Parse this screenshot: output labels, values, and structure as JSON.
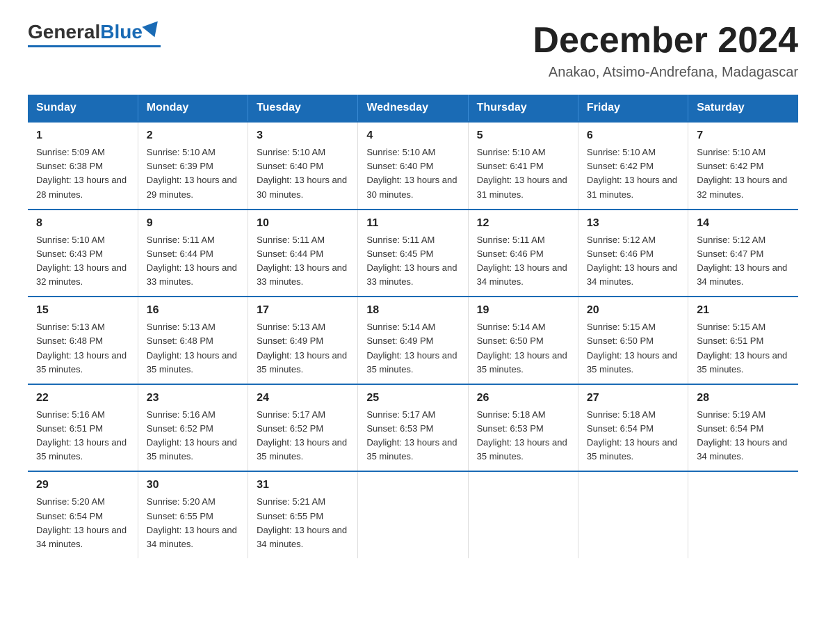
{
  "header": {
    "logo_general": "General",
    "logo_blue": "Blue",
    "month_year": "December 2024",
    "location": "Anakao, Atsimo-Andrefana, Madagascar"
  },
  "days_of_week": [
    "Sunday",
    "Monday",
    "Tuesday",
    "Wednesday",
    "Thursday",
    "Friday",
    "Saturday"
  ],
  "weeks": [
    [
      {
        "day": "1",
        "sunrise": "5:09 AM",
        "sunset": "6:38 PM",
        "daylight": "13 hours and 28 minutes."
      },
      {
        "day": "2",
        "sunrise": "5:10 AM",
        "sunset": "6:39 PM",
        "daylight": "13 hours and 29 minutes."
      },
      {
        "day": "3",
        "sunrise": "5:10 AM",
        "sunset": "6:40 PM",
        "daylight": "13 hours and 30 minutes."
      },
      {
        "day": "4",
        "sunrise": "5:10 AM",
        "sunset": "6:40 PM",
        "daylight": "13 hours and 30 minutes."
      },
      {
        "day": "5",
        "sunrise": "5:10 AM",
        "sunset": "6:41 PM",
        "daylight": "13 hours and 31 minutes."
      },
      {
        "day": "6",
        "sunrise": "5:10 AM",
        "sunset": "6:42 PM",
        "daylight": "13 hours and 31 minutes."
      },
      {
        "day": "7",
        "sunrise": "5:10 AM",
        "sunset": "6:42 PM",
        "daylight": "13 hours and 32 minutes."
      }
    ],
    [
      {
        "day": "8",
        "sunrise": "5:10 AM",
        "sunset": "6:43 PM",
        "daylight": "13 hours and 32 minutes."
      },
      {
        "day": "9",
        "sunrise": "5:11 AM",
        "sunset": "6:44 PM",
        "daylight": "13 hours and 33 minutes."
      },
      {
        "day": "10",
        "sunrise": "5:11 AM",
        "sunset": "6:44 PM",
        "daylight": "13 hours and 33 minutes."
      },
      {
        "day": "11",
        "sunrise": "5:11 AM",
        "sunset": "6:45 PM",
        "daylight": "13 hours and 33 minutes."
      },
      {
        "day": "12",
        "sunrise": "5:11 AM",
        "sunset": "6:46 PM",
        "daylight": "13 hours and 34 minutes."
      },
      {
        "day": "13",
        "sunrise": "5:12 AM",
        "sunset": "6:46 PM",
        "daylight": "13 hours and 34 minutes."
      },
      {
        "day": "14",
        "sunrise": "5:12 AM",
        "sunset": "6:47 PM",
        "daylight": "13 hours and 34 minutes."
      }
    ],
    [
      {
        "day": "15",
        "sunrise": "5:13 AM",
        "sunset": "6:48 PM",
        "daylight": "13 hours and 35 minutes."
      },
      {
        "day": "16",
        "sunrise": "5:13 AM",
        "sunset": "6:48 PM",
        "daylight": "13 hours and 35 minutes."
      },
      {
        "day": "17",
        "sunrise": "5:13 AM",
        "sunset": "6:49 PM",
        "daylight": "13 hours and 35 minutes."
      },
      {
        "day": "18",
        "sunrise": "5:14 AM",
        "sunset": "6:49 PM",
        "daylight": "13 hours and 35 minutes."
      },
      {
        "day": "19",
        "sunrise": "5:14 AM",
        "sunset": "6:50 PM",
        "daylight": "13 hours and 35 minutes."
      },
      {
        "day": "20",
        "sunrise": "5:15 AM",
        "sunset": "6:50 PM",
        "daylight": "13 hours and 35 minutes."
      },
      {
        "day": "21",
        "sunrise": "5:15 AM",
        "sunset": "6:51 PM",
        "daylight": "13 hours and 35 minutes."
      }
    ],
    [
      {
        "day": "22",
        "sunrise": "5:16 AM",
        "sunset": "6:51 PM",
        "daylight": "13 hours and 35 minutes."
      },
      {
        "day": "23",
        "sunrise": "5:16 AM",
        "sunset": "6:52 PM",
        "daylight": "13 hours and 35 minutes."
      },
      {
        "day": "24",
        "sunrise": "5:17 AM",
        "sunset": "6:52 PM",
        "daylight": "13 hours and 35 minutes."
      },
      {
        "day": "25",
        "sunrise": "5:17 AM",
        "sunset": "6:53 PM",
        "daylight": "13 hours and 35 minutes."
      },
      {
        "day": "26",
        "sunrise": "5:18 AM",
        "sunset": "6:53 PM",
        "daylight": "13 hours and 35 minutes."
      },
      {
        "day": "27",
        "sunrise": "5:18 AM",
        "sunset": "6:54 PM",
        "daylight": "13 hours and 35 minutes."
      },
      {
        "day": "28",
        "sunrise": "5:19 AM",
        "sunset": "6:54 PM",
        "daylight": "13 hours and 34 minutes."
      }
    ],
    [
      {
        "day": "29",
        "sunrise": "5:20 AM",
        "sunset": "6:54 PM",
        "daylight": "13 hours and 34 minutes."
      },
      {
        "day": "30",
        "sunrise": "5:20 AM",
        "sunset": "6:55 PM",
        "daylight": "13 hours and 34 minutes."
      },
      {
        "day": "31",
        "sunrise": "5:21 AM",
        "sunset": "6:55 PM",
        "daylight": "13 hours and 34 minutes."
      },
      null,
      null,
      null,
      null
    ]
  ],
  "labels": {
    "sunrise": "Sunrise: ",
    "sunset": "Sunset: ",
    "daylight": "Daylight: "
  }
}
